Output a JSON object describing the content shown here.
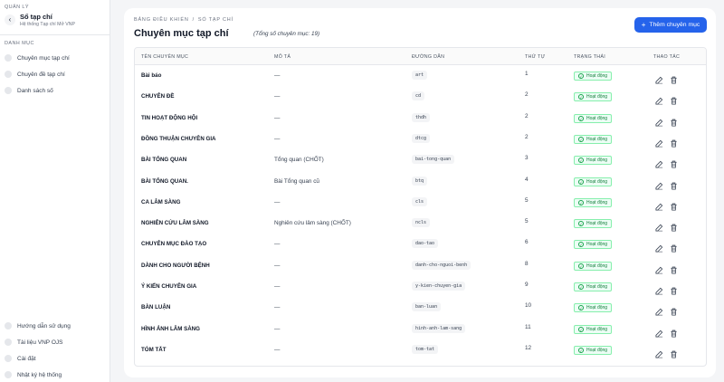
{
  "sidebar": {
    "section_label": "QUẢN LÝ",
    "title": "Sổ tạp chí",
    "subtitle": "Hệ thống Tạp chí Mở VNP",
    "menu_label": "DANH MỤC",
    "items": [
      "Chuyên mục tạp chí",
      "Chuyên đề tạp chí",
      "Danh sách số"
    ],
    "bottom_items": [
      "Hướng dẫn sử dụng",
      "Tài liệu VNP OJS",
      "Cài đặt",
      "Nhật ký hệ thống"
    ]
  },
  "breadcrumb": [
    "BẢNG ĐIỀU KHIỂN",
    "SỔ TẠP CHÍ"
  ],
  "breadcrumb_sep": "/",
  "page": {
    "title": "Chuyên mục tạp chí",
    "count_text": "(Tổng số chuyên mục: 19)",
    "add_button": "Thêm chuyên mục",
    "add_icon": "+"
  },
  "table": {
    "headers": [
      "TÊN CHUYÊN MỤC",
      "MÔ TẢ",
      "ĐƯỜNG DẪN",
      "THỨ TỰ",
      "TRẠNG THÁI",
      "THAO TÁC"
    ],
    "rows": [
      {
        "name": "Bài báo",
        "desc": "—",
        "path": "art",
        "order": "1",
        "status": "Hoạt động"
      },
      {
        "name": "CHUYÊN ĐỀ",
        "desc": "—",
        "path": "cd",
        "order": "2",
        "status": "Hoạt động"
      },
      {
        "name": "TIN HOẠT ĐỘNG HỘI",
        "desc": "—",
        "path": "thdh",
        "order": "2",
        "status": "Hoạt động"
      },
      {
        "name": "ĐỒNG THUẬN CHUYÊN GIA",
        "desc": "—",
        "path": "dtcg",
        "order": "2",
        "status": "Hoạt động"
      },
      {
        "name": "BÀI TỔNG QUAN",
        "desc": "Tổng quan (CHỐT)",
        "path": "bai-tong-quan",
        "order": "3",
        "status": "Hoạt động"
      },
      {
        "name": "BÀI TỔNG QUAN.",
        "desc": "Bài Tổng quan cũ",
        "path": "btq",
        "order": "4",
        "status": "Hoạt động"
      },
      {
        "name": "CA LÂM SÀNG",
        "desc": "—",
        "path": "cls",
        "order": "5",
        "status": "Hoạt động"
      },
      {
        "name": "NGHIÊN CỨU LÂM SÀNG",
        "desc": "Nghiên cứu lâm sàng (CHỐT)",
        "path": "ncls",
        "order": "5",
        "status": "Hoạt động"
      },
      {
        "name": "CHUYÊN MỤC ĐÀO TẠO",
        "desc": "—",
        "path": "dao-tao",
        "order": "6",
        "status": "Hoạt động"
      },
      {
        "name": "DÀNH CHO NGƯỜI BỆNH",
        "desc": "—",
        "path": "danh-cho-nguoi-benh",
        "order": "8",
        "status": "Hoạt động"
      },
      {
        "name": "Ý KIẾN CHUYÊN GIA",
        "desc": "—",
        "path": "y-kien-chuyen-gia",
        "order": "9",
        "status": "Hoạt động"
      },
      {
        "name": "BÀN LUẬN",
        "desc": "—",
        "path": "ban-luan",
        "order": "10",
        "status": "Hoạt động"
      },
      {
        "name": "HÌNH ẢNH LÂM SÀNG",
        "desc": "—",
        "path": "hinh-anh-lam-sang",
        "order": "11",
        "status": "Hoạt động"
      },
      {
        "name": "TÓM TẮT",
        "desc": "—",
        "path": "tom-tat",
        "order": "12",
        "status": "Hoạt động"
      }
    ]
  },
  "icons": {
    "back": "chevron-left-icon",
    "edit": "pencil-icon",
    "delete": "trash-icon",
    "status": "check-circle-icon"
  },
  "colors": {
    "primary": "#2563eb",
    "success": "#15803d",
    "success_bg": "#ecfdf5"
  }
}
